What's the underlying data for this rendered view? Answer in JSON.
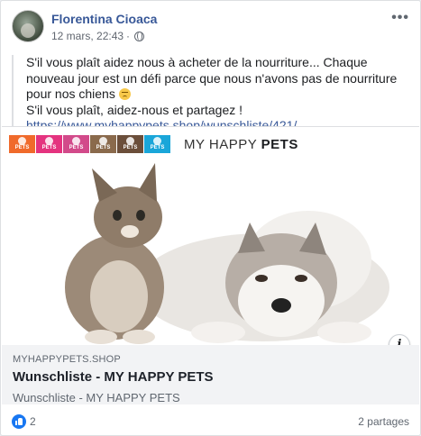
{
  "post": {
    "author": "Florentina Cioaca",
    "timestamp": "12 mars, 22:43",
    "separator": "·",
    "privacy_icon": "globe-icon",
    "more_icon": "more-options-icon",
    "more_label": "•••",
    "message": {
      "line1": "S'il vous plaît aidez nous à acheter de la nourriture... Chaque nouveau jour est un défi parce que nous n'avons pas de nourriture pour nos chiens",
      "emoji": "sad-face-emoji",
      "line2": "S'il vous plaît, aidez-nous et partagez !",
      "link": "https://www.myhappypets.shop/wunschliste/421/"
    }
  },
  "card": {
    "brand": {
      "tiles": [
        {
          "label": "PETS",
          "color": "#f06a2b"
        },
        {
          "label": "PETS",
          "color": "#e4337f"
        },
        {
          "label": "PETS",
          "color": "#d24a8a"
        },
        {
          "label": "PETS",
          "color": "#8a6a4c"
        },
        {
          "label": "PETS",
          "color": "#6b4e3a"
        },
        {
          "label": "PETS",
          "color": "#1aa6d9"
        }
      ],
      "name_prefix": "MY HAPPY ",
      "name_bold": "PETS"
    },
    "info_icon": "info-icon",
    "info_label": "i",
    "domain": "MYHAPPYPETS.SHOP",
    "title": "Wunschliste - MY HAPPY PETS",
    "description": "Wunschliste - MY HAPPY PETS"
  },
  "footer": {
    "like_icon": "like-reaction-icon",
    "like_count": "2",
    "shares": "2 partages"
  },
  "colors": {
    "link": "#385898",
    "like": "#1877f2",
    "card_bg": "#f2f3f5"
  }
}
